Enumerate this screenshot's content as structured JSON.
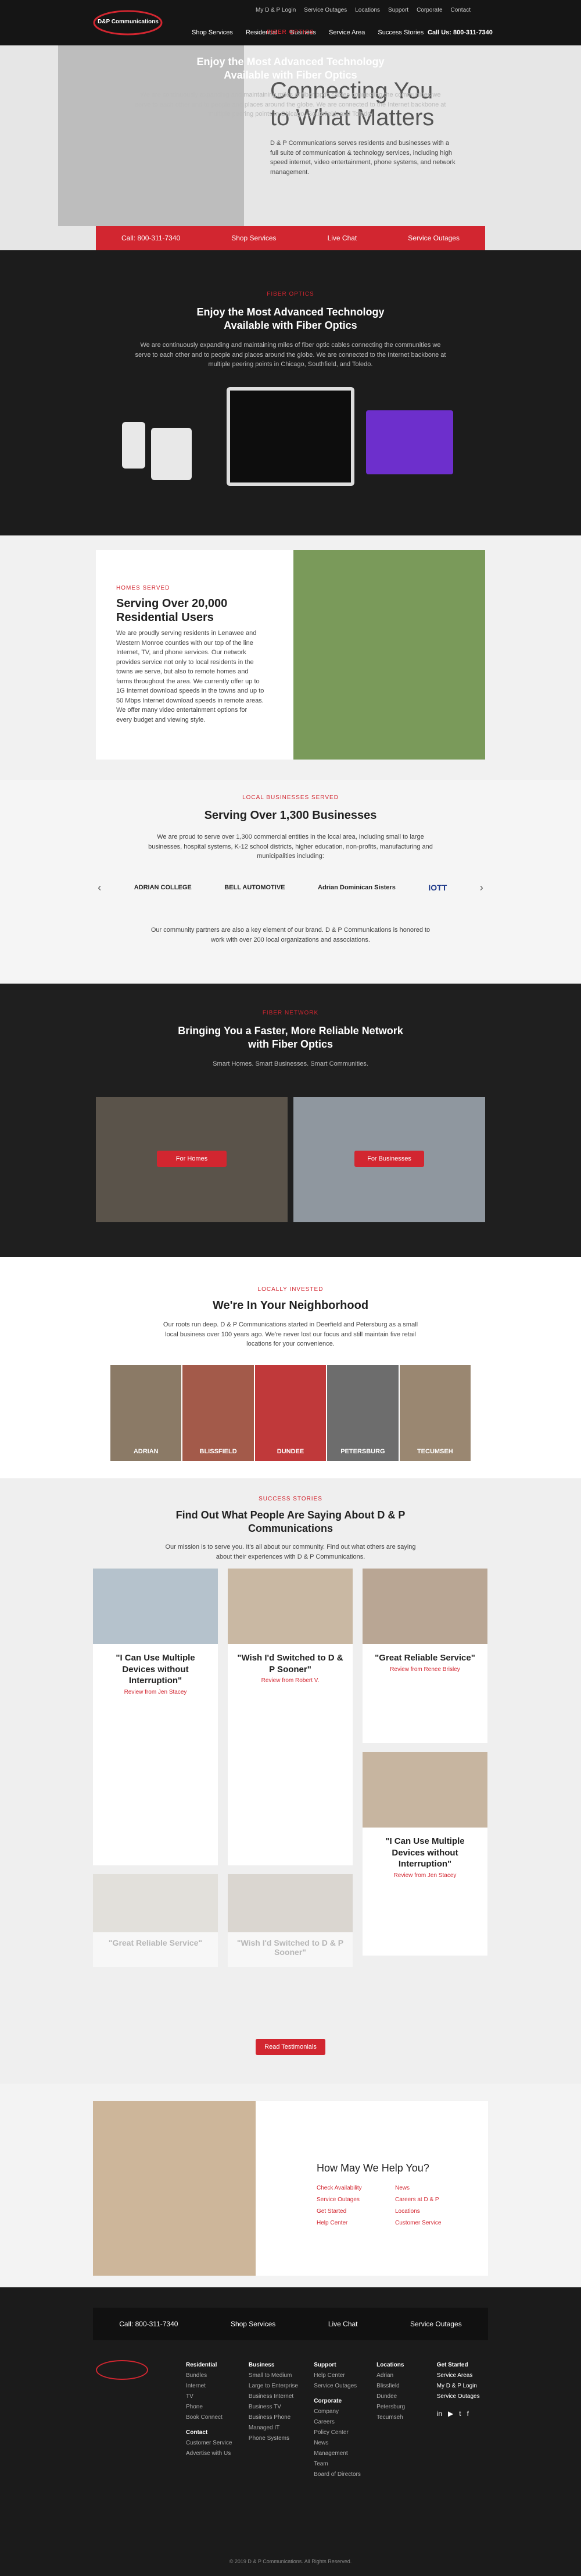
{
  "header": {
    "brand": "D&P Communications",
    "top_links": [
      "My D & P Login",
      "Service Outages",
      "Locations",
      "Support",
      "Corporate",
      "Contact"
    ],
    "nav": [
      "Shop Services",
      "Residential",
      "Business",
      "Service Area",
      "Success Stories"
    ],
    "call_cta": "Call Us: 800-311-7340"
  },
  "hero": {
    "title_line1": "Connecting You",
    "title_line2": "to What Matters",
    "subtitle": "D & P Communications serves residents and businesses with a full suite of communication & technology services, including high speed internet, video entertainment, phone systems, and network management.",
    "ctas": [
      "Call: 800-311-7340",
      "Shop Services",
      "Live Chat",
      "Service Outages"
    ]
  },
  "fiber": {
    "eyebrow": "Fiber Optics",
    "title": "Enjoy the Most Advanced Technology Available with Fiber Optics",
    "text": "We are continuously expanding and maintaining miles of fiber optic cables connecting the communities we serve to each other and to people and places around the globe. We are connected to the Internet backbone at multiple peering points in Chicago, Southfield, and Toledo."
  },
  "homes": {
    "eyebrow": "Homes Served",
    "title": "Serving Over 20,000 Residential Users",
    "text": "We are proudly serving residents in Lenawee and Western Monroe counties with our top of the line Internet, TV, and phone services. Our network provides service not only to local residents in the towns we serve, but also to remote homes and farms throughout the area. We currently offer up to 1G Internet download speeds in the towns and up to 50 Mbps Internet download speeds in remote areas. We offer many video entertainment options for every budget and viewing style."
  },
  "business": {
    "eyebrow": "Local Businesses Served",
    "title": "Serving Over 1,300 Businesses",
    "text": "We are proud to serve over 1,300 commercial entities in the local area, including small to large businesses, hospital systems, K-12 school districts, higher education, non-profits, manufacturing and municipalities including:",
    "logos": [
      "ADRIAN COLLEGE",
      "BELL AUTOMOTIVE",
      "Adrian Dominican Sisters",
      "IOTT"
    ],
    "footnote": "Our community partners are also a key element of our brand. D & P Communications is honored to work with over 200 local organizations and associations."
  },
  "network": {
    "eyebrow": "Fiber Network",
    "title": "Bringing You a Faster, More Reliable Network with Fiber Optics",
    "subtitle": "Smart Homes. Smart Businesses. Smart Communities.",
    "buttons": [
      "For Homes",
      "For Businesses"
    ]
  },
  "neighborhood": {
    "eyebrow": "Locally Invested",
    "title": "We're In Your Neighborhood",
    "text": "Our roots run deep. D & P Communications started in Deerfield and Petersburg as a small local business over 100 years ago. We're never lost our focus and still maintain five retail locations for your convenience.",
    "locations": [
      "ADRIAN",
      "BLISSFIELD",
      "DUNDEE",
      "PETERSBURG",
      "TECUMSEH"
    ]
  },
  "stories": {
    "eyebrow": "Success Stories",
    "title": "Find Out What People Are Saying About D & P Communications",
    "subtitle": "Our mission is to serve you. It's all about our community. Find out what others are saying about their experiences with D & P Communications.",
    "cards": [
      {
        "title": "\"I Can Use Multiple Devices without Interruption\"",
        "byline": "Review from Jen Stacey"
      },
      {
        "title": "\"Wish I'd Switched to D & P Sooner\"",
        "byline": "Review from Robert V."
      },
      {
        "title": "\"Great Reliable Service\"",
        "byline": "Review from Renee Brisley"
      },
      {
        "title": "\"I Can Use Multiple Devices without Interruption\"",
        "byline": "Review from Jen Stacey"
      },
      {
        "title": "\"Great Reliable Service\"",
        "byline": ""
      },
      {
        "title": "\"Wish I'd Switched to D & P Sooner\"",
        "byline": ""
      }
    ],
    "button": "Read Testimonials"
  },
  "help": {
    "title": "How May We Help You?",
    "links_left": [
      "Check Availability",
      "Service Outages",
      "Get Started",
      "Help Center"
    ],
    "links_right": [
      "News",
      "Careers at D & P",
      "Locations",
      "Customer Service"
    ]
  },
  "footer_bar": [
    "Call: 800-311-7340",
    "Shop Services",
    "Live Chat",
    "Service Outages"
  ],
  "footer": {
    "cols": [
      {
        "heading": "Residential",
        "items": [
          "Bundles",
          "Internet",
          "TV",
          "Phone",
          "Book Connect"
        ]
      },
      {
        "heading": "Business",
        "items": [
          "Small to Medium",
          "Large to Enterprise",
          "Business Internet",
          "Business TV",
          "Business Phone",
          "Managed IT",
          "Phone Systems"
        ]
      },
      {
        "heading": "Support",
        "items": [
          "Help Center",
          "Service Outages"
        ]
      },
      {
        "heading": "Locations",
        "items": [
          "Adrian",
          "Blissfield",
          "Dundee",
          "Petersburg",
          "Tecumseh"
        ]
      },
      {
        "heading": "Get Started",
        "items": [
          "Service Areas",
          "My D & P Login",
          "Service Outages"
        ]
      }
    ],
    "contact_heading": "Contact",
    "contact_items": [
      "Customer Service",
      "Advertise with Us"
    ],
    "corporate_heading": "Corporate",
    "corporate_items": [
      "Company",
      "Careers",
      "Policy Center",
      "News",
      "Management Team",
      "Board of Directors"
    ],
    "copyright": "© 2019 D & P Communications. All Rights Reserved."
  },
  "colors": {
    "accent": "#d22630",
    "dark": "#1f1f1f"
  }
}
